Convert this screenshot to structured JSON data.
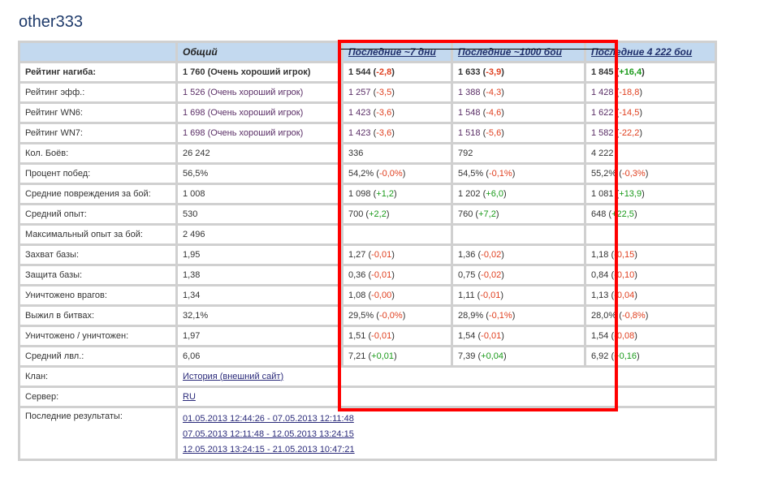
{
  "title": "other333",
  "headers": [
    "",
    "Общий",
    "Последние ~7 дни",
    "Последние ~1000 бои",
    "Последние 4 222 бои"
  ],
  "rows": [
    {
      "label": "Рейтинг нагиба:",
      "bold": true,
      "cells": [
        {
          "v": "1 760 (Очень хороший игрок)",
          "d": ""
        },
        {
          "v": "1 544",
          "d": "-2,8"
        },
        {
          "v": "1 633",
          "d": "-3,9"
        },
        {
          "v": "1 845",
          "d": "+16,4"
        }
      ]
    },
    {
      "label": "Рейтинг эфф.:",
      "purple": true,
      "cells": [
        {
          "v": "1 526 (Очень хороший игрок)",
          "d": ""
        },
        {
          "v": "1 257",
          "d": "-3,5"
        },
        {
          "v": "1 388",
          "d": "-4,3"
        },
        {
          "v": "1 428",
          "d": "-18,8"
        }
      ]
    },
    {
      "label": "Рейтинг WN6:",
      "purple": true,
      "cells": [
        {
          "v": "1 698 (Очень хороший игрок)",
          "d": ""
        },
        {
          "v": "1 423",
          "d": "-3,6"
        },
        {
          "v": "1 548",
          "d": "-4,6"
        },
        {
          "v": "1 622",
          "d": "-14,5"
        }
      ]
    },
    {
      "label": "Рейтинг WN7:",
      "purple": true,
      "cells": [
        {
          "v": "1 698 (Очень хороший игрок)",
          "d": ""
        },
        {
          "v": "1 423",
          "d": "-3,6"
        },
        {
          "v": "1 518",
          "d": "-5,6"
        },
        {
          "v": "1 582",
          "d": "-22,2"
        }
      ]
    },
    {
      "label": "Кол. Боёв:",
      "cells": [
        {
          "v": "26 242",
          "d": ""
        },
        {
          "v": "336",
          "d": ""
        },
        {
          "v": "792",
          "d": ""
        },
        {
          "v": "4 222",
          "d": ""
        }
      ]
    },
    {
      "label": "Процент побед:",
      "cells": [
        {
          "v": "56,5%",
          "d": ""
        },
        {
          "v": "54,2%",
          "d": "-0,0%"
        },
        {
          "v": "54,5%",
          "d": "-0,1%"
        },
        {
          "v": "55,2%",
          "d": "-0,3%"
        }
      ]
    },
    {
      "label": "Средние повреждения за бой:",
      "cells": [
        {
          "v": "1 008",
          "d": ""
        },
        {
          "v": "1 098",
          "d": "+1,2"
        },
        {
          "v": "1 202",
          "d": "+6,0"
        },
        {
          "v": "1 081",
          "d": "+13,9"
        }
      ]
    },
    {
      "label": "Средний опыт:",
      "cells": [
        {
          "v": "530",
          "d": ""
        },
        {
          "v": "700",
          "d": "+2,2"
        },
        {
          "v": "760",
          "d": "+7,2"
        },
        {
          "v": "648",
          "d": "+22,5"
        }
      ]
    },
    {
      "label": "Максимальный опыт за бой:",
      "cells": [
        {
          "v": "2 496",
          "d": ""
        },
        {
          "v": "",
          "d": ""
        },
        {
          "v": "",
          "d": ""
        },
        {
          "v": "",
          "d": ""
        }
      ]
    },
    {
      "label": "Захват базы:",
      "cells": [
        {
          "v": "1,95",
          "d": ""
        },
        {
          "v": "1,27",
          "d": "-0,01"
        },
        {
          "v": "1,36",
          "d": "-0,02"
        },
        {
          "v": "1,18",
          "d": "-0,15"
        }
      ]
    },
    {
      "label": "Защита базы:",
      "cells": [
        {
          "v": "1,38",
          "d": ""
        },
        {
          "v": "0,36",
          "d": "-0,01"
        },
        {
          "v": "0,75",
          "d": "-0,02"
        },
        {
          "v": "0,84",
          "d": "-0,10"
        }
      ]
    },
    {
      "label": "Уничтожено врагов:",
      "cells": [
        {
          "v": "1,34",
          "d": ""
        },
        {
          "v": "1,08",
          "d": "-0,00"
        },
        {
          "v": "1,11",
          "d": "-0,01"
        },
        {
          "v": "1,13",
          "d": "-0,04"
        }
      ]
    },
    {
      "label": "Выжил в битвах:",
      "cells": [
        {
          "v": "32,1%",
          "d": ""
        },
        {
          "v": "29,5%",
          "d": "-0,0%"
        },
        {
          "v": "28,9%",
          "d": "-0,1%"
        },
        {
          "v": "28,0%",
          "d": "-0,8%"
        }
      ]
    },
    {
      "label": "Уничтожено / уничтожен:",
      "cells": [
        {
          "v": "1,97",
          "d": ""
        },
        {
          "v": "1,51",
          "d": "-0,01"
        },
        {
          "v": "1,54",
          "d": "-0,01"
        },
        {
          "v": "1,54",
          "d": "-0,08"
        }
      ]
    },
    {
      "label": "Средний лвл.:",
      "cells": [
        {
          "v": "6,06",
          "d": ""
        },
        {
          "v": "7,21",
          "d": "+0,01"
        },
        {
          "v": "7,39",
          "d": "+0,04"
        },
        {
          "v": "6,92",
          "d": "+0,16"
        }
      ]
    }
  ],
  "clan": {
    "label": "Клан:",
    "link": "История (внешний сайт)"
  },
  "server": {
    "label": "Сервер:",
    "link": "RU"
  },
  "results": {
    "label": "Последние результаты:",
    "links": [
      "01.05.2013 12:44:26 - 07.05.2013 12:11:48",
      "07.05.2013 12:11:48 - 12.05.2013 13:24:15",
      "12.05.2013 13:24:15 - 21.05.2013 10:47:21"
    ]
  },
  "colors": {
    "highlight": "#ff0000",
    "header_bg": "#c3d9ef",
    "negative": "#e04020",
    "positive": "#1a9a1a"
  }
}
